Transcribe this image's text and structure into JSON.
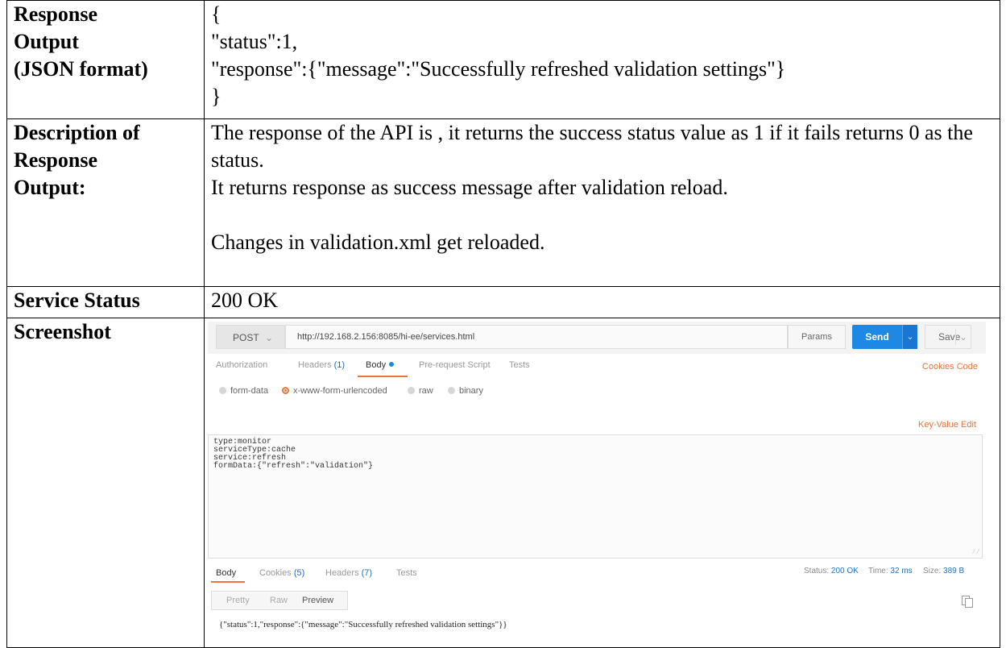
{
  "rows": {
    "response_output": {
      "label_lines": [
        "Response",
        "Output",
        "(JSON format)"
      ],
      "json_lines": [
        "{",
        "\"status\":1,",
        "\"response\":{\"message\":\"Successfully refreshed validation settings\"}",
        "}"
      ]
    },
    "description": {
      "label_lines": [
        "Description of",
        "Response",
        "Output:"
      ],
      "para1": "The response of the API is , it returns the success status value as 1 if it fails returns 0 as the status.",
      "para2": "It returns response as success message after validation reload.",
      "para3": "Changes in validation.xml get reloaded."
    },
    "service_status": {
      "label": "Service Status",
      "value": "200 OK"
    },
    "screenshot": {
      "label": "Screenshot"
    }
  },
  "postman": {
    "method": "POST",
    "url": "http://192.168.2.156:8085/hi-ee/services.html",
    "params_label": "Params",
    "send_label": "Send",
    "save_label": "Save",
    "request_tabs": {
      "authorization": "Authorization",
      "headers": "Headers",
      "headers_count": "(1)",
      "body": "Body",
      "prerequest": "Pre-request Script",
      "tests": "Tests"
    },
    "cookies_link": "Cookies",
    "code_link": "Code",
    "body_modes": [
      "form-data",
      "x-www-form-urlencoded",
      "raw",
      "binary"
    ],
    "selected_body_mode": "x-www-form-urlencoded",
    "key_value_edit": "Key-Value Edit",
    "editor_lines": [
      "type:monitor",
      "serviceType:cache",
      "service:refresh",
      "formData:{\"refresh\":\"validation\"}"
    ],
    "response_tabs": {
      "body": "Body",
      "cookies": "Cookies",
      "cookies_count": "(5)",
      "headers": "Headers",
      "headers_count": "(7)",
      "tests": "Tests"
    },
    "status_label": "Status:",
    "status_value": "200 OK",
    "time_label": "Time:",
    "time_value": "32 ms",
    "size_label": "Size:",
    "size_value": "389 B",
    "format_buttons": [
      "Pretty",
      "Raw",
      "Preview"
    ],
    "response_body": "{\"status\":1,\"response\":{\"message\":\"Successfully refreshed validation settings\"}}",
    "accent_color": "#e8763a",
    "send_color": "#1e88e5"
  }
}
